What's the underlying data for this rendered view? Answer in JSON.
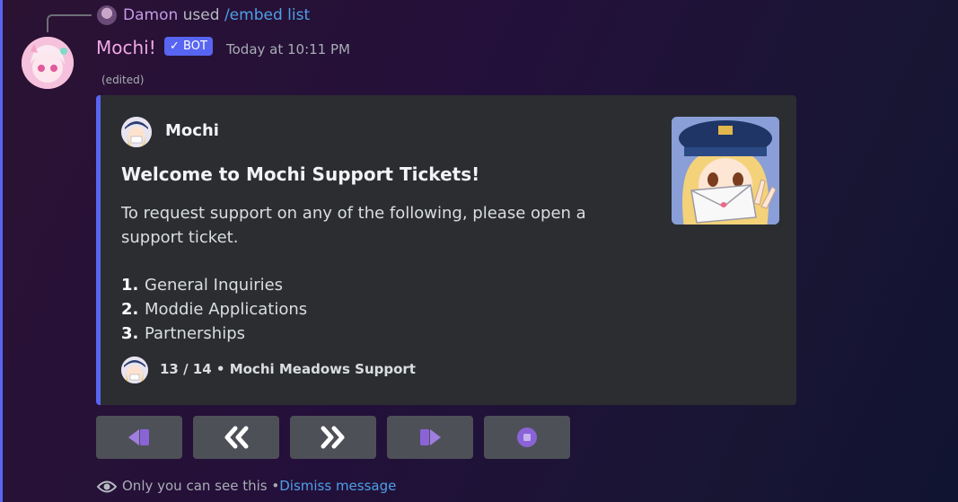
{
  "reply": {
    "username": "Damon",
    "used": "used",
    "command": "/embed list"
  },
  "message": {
    "username": "Mochi!",
    "bot_badge": "✓ BOT",
    "timestamp": "Today at 10:11 PM",
    "edited": "(edited)"
  },
  "embed": {
    "accent_color": "#5865f2",
    "author": "Mochi",
    "title": "Welcome to Mochi Support Tickets!",
    "description": "To request support on any of the following, please open a support ticket.",
    "list": [
      {
        "num": "1.",
        "text": "General Inquiries"
      },
      {
        "num": "2.",
        "text": "Moddie Applications"
      },
      {
        "num": "3.",
        "text": "Partnerships"
      }
    ],
    "footer": "13 / 14 • Mochi Meadows Support"
  },
  "buttons": [
    {
      "name": "first-page-icon"
    },
    {
      "name": "previous-page-icon"
    },
    {
      "name": "next-page-icon"
    },
    {
      "name": "last-page-icon"
    },
    {
      "name": "stop-icon"
    }
  ],
  "ephemeral": {
    "notice": "Only you can see this",
    "separator": "•",
    "dismiss": "Dismiss message"
  }
}
